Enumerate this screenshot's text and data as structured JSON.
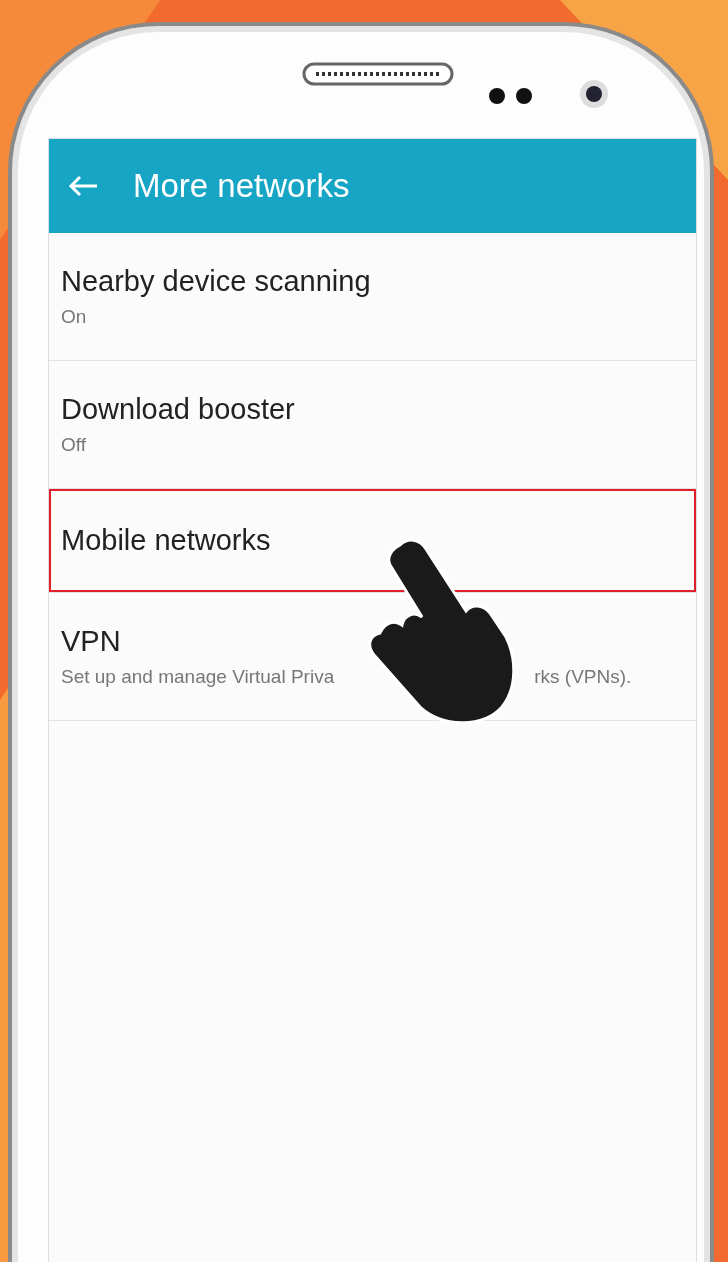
{
  "app_bar": {
    "title": "More networks"
  },
  "items": [
    {
      "title": "Nearby device scanning",
      "subtitle": [
        "On"
      ],
      "highlighted": false
    },
    {
      "title": "Download booster",
      "subtitle": [
        "Off"
      ],
      "highlighted": false
    },
    {
      "title": "Mobile networks",
      "highlighted": true
    },
    {
      "title": "VPN",
      "subtitle": [
        "Set up and manage Virtual Priva",
        "rks (VPNs)."
      ],
      "highlighted": false
    }
  ]
}
